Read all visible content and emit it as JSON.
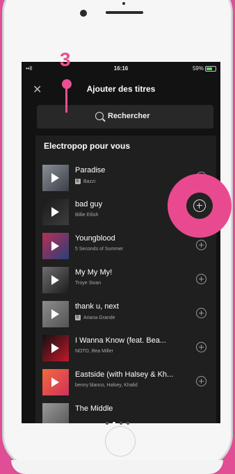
{
  "status_bar": {
    "signal": "••ll",
    "time": "16:16",
    "battery": "59%"
  },
  "header": {
    "title": "Ajouter des titres",
    "close_icon": "close-icon"
  },
  "search": {
    "label": "Rechercher"
  },
  "section": {
    "title": "Electropop pour vous"
  },
  "tracks": [
    {
      "title": "Paradise",
      "artist": "Bazzi",
      "explicit": "E"
    },
    {
      "title": "bad guy",
      "artist": "Billie Eilish",
      "explicit": ""
    },
    {
      "title": "Youngblood",
      "artist": "5 Seconds of Summer",
      "explicit": ""
    },
    {
      "title": "My My My!",
      "artist": "Troye Sivan",
      "explicit": ""
    },
    {
      "title": "thank u, next",
      "artist": "Ariana Grande",
      "explicit": "E"
    },
    {
      "title": "I Wanna Know (feat. Bea...",
      "artist": "NOTD, Bea Miller",
      "explicit": ""
    },
    {
      "title": "Eastside (with Halsey & Kh...",
      "artist": "benny blanco, Halsey, Khalid",
      "explicit": ""
    },
    {
      "title": "The Middle",
      "artist": "",
      "explicit": ""
    }
  ],
  "annotation": {
    "step": "3"
  },
  "colors": {
    "background": "#e04e96",
    "accent": "#ea4f8f",
    "screen": "#121212"
  }
}
